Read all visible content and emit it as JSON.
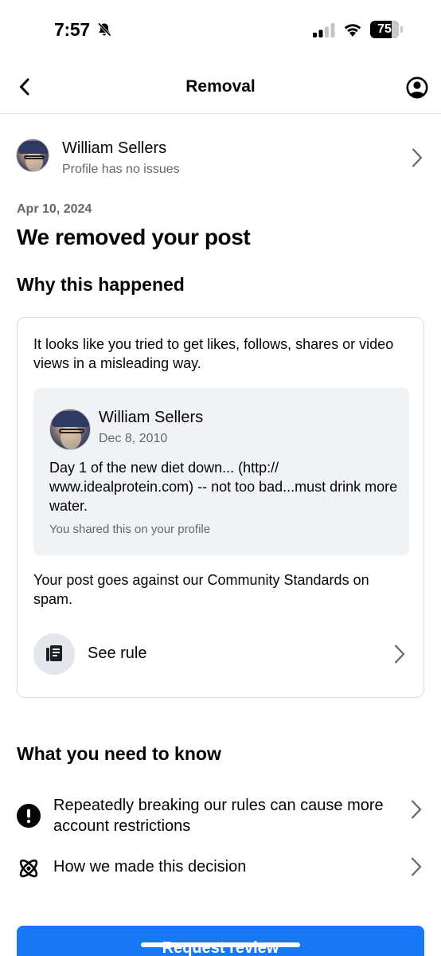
{
  "status_bar": {
    "time": "7:57",
    "battery": "75",
    "battery_level_percent": 75,
    "icons": [
      "bell-slash-icon",
      "cellular-signal-icon",
      "wifi-icon",
      "battery-icon"
    ]
  },
  "nav": {
    "title": "Removal",
    "back_icon": "chevron-left-icon",
    "account_icon": "account-circle-icon"
  },
  "profile": {
    "name": "William Sellers",
    "status": "Profile has no issues"
  },
  "removal": {
    "date": "Apr 10, 2024",
    "headline": "We removed your post"
  },
  "why": {
    "title": "Why this happened",
    "reason": "It looks like you tried to get likes, follows, shares or video views in a misleading way.",
    "post": {
      "author": "William Sellers",
      "date": "Dec 8, 2010",
      "body": "Day 1 of the new diet down... (http:// www.idealprotein.com) -- not too bad...must drink more water.",
      "shared_note": "You shared this on your profile"
    },
    "standards": "Your post goes against our Community Standards on spam.",
    "see_rule": "See rule"
  },
  "know": {
    "title": "What you need to know",
    "items": [
      {
        "label": "Repeatedly breaking our rules can cause more account restrictions",
        "icon": "exclamation-circle-icon"
      },
      {
        "label": "How we made this decision",
        "icon": "atom-icon"
      }
    ]
  },
  "action": {
    "request_review": "Request review"
  },
  "colors": {
    "accent": "#1877f2",
    "secondary_text": "#65676b",
    "card_background": "#f0f2f5",
    "border": "#dadde1"
  }
}
